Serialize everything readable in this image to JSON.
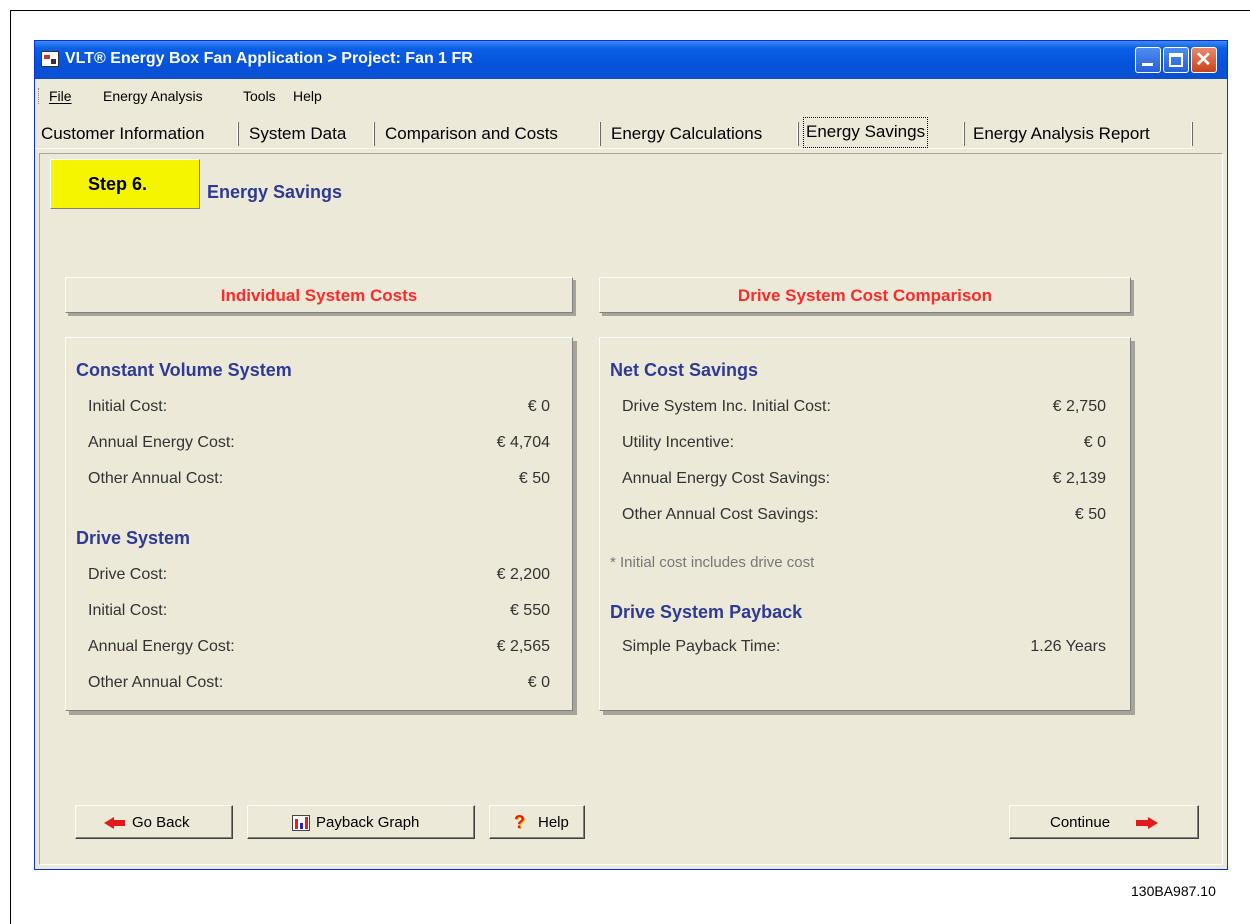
{
  "window": {
    "title": "VLT® Energy Box Fan Application > Project: Fan 1 FR",
    "icon": "app-icon"
  },
  "menu": {
    "items": [
      {
        "label": "File",
        "accel": "F"
      },
      {
        "label": "Energy Analysis",
        "accel": "A"
      },
      {
        "label": "Tools",
        "accel": "T"
      },
      {
        "label": "Help",
        "accel": "H"
      }
    ]
  },
  "tabs": [
    {
      "label": "Customer Information",
      "active": false
    },
    {
      "label": "System Data",
      "active": false
    },
    {
      "label": "Comparison and Costs",
      "active": false
    },
    {
      "label": "Energy Calculations",
      "active": false
    },
    {
      "label": "Energy Savings",
      "active": true
    },
    {
      "label": "Energy Analysis Report",
      "active": false
    }
  ],
  "step": {
    "label": "Step 6.",
    "title": "Energy Savings",
    "color": "#f5f500"
  },
  "left_panel": {
    "header": "Individual System Costs",
    "constant": {
      "heading": "Constant Volume System",
      "rows": [
        {
          "label": "Initial Cost:",
          "value": "€ 0"
        },
        {
          "label": "Annual Energy Cost:",
          "value": "€ 4,704"
        },
        {
          "label": "Other Annual Cost:",
          "value": "€ 50"
        }
      ]
    },
    "drive": {
      "heading": "Drive System",
      "rows": [
        {
          "label": "Drive Cost:",
          "value": "€ 2,200"
        },
        {
          "label": "Initial Cost:",
          "value": "€ 550"
        },
        {
          "label": "Annual Energy Cost:",
          "value": "€ 2,565"
        },
        {
          "label": "Other Annual Cost:",
          "value": "€ 0"
        }
      ]
    }
  },
  "right_panel": {
    "header": "Drive System Cost Comparison",
    "net": {
      "heading": "Net Cost Savings",
      "rows": [
        {
          "label": "Drive System Inc. Initial Cost:",
          "value": "€ 2,750"
        },
        {
          "label": "Utility Incentive:",
          "value": "€ 0"
        },
        {
          "label": "Annual Energy Cost Savings:",
          "value": "€ 2,139"
        },
        {
          "label": "Other Annual Cost Savings:",
          "value": "€ 50"
        }
      ]
    },
    "note": "* Initial cost includes drive cost",
    "payback": {
      "heading": "Drive System Payback",
      "rows": [
        {
          "label": "Simple Payback Time:",
          "value": "1.26 Years"
        }
      ]
    }
  },
  "buttons": {
    "go_back": "Go Back",
    "payback_graph": "Payback Graph",
    "help": "Help",
    "continue": "Continue"
  },
  "colors": {
    "header_red": "#ff2a2a",
    "heading_blue": "#2e3a94",
    "arrow_red": "#e21a1a",
    "title_bar_blue": "#0653db"
  },
  "figure_id": "130BA987.10"
}
